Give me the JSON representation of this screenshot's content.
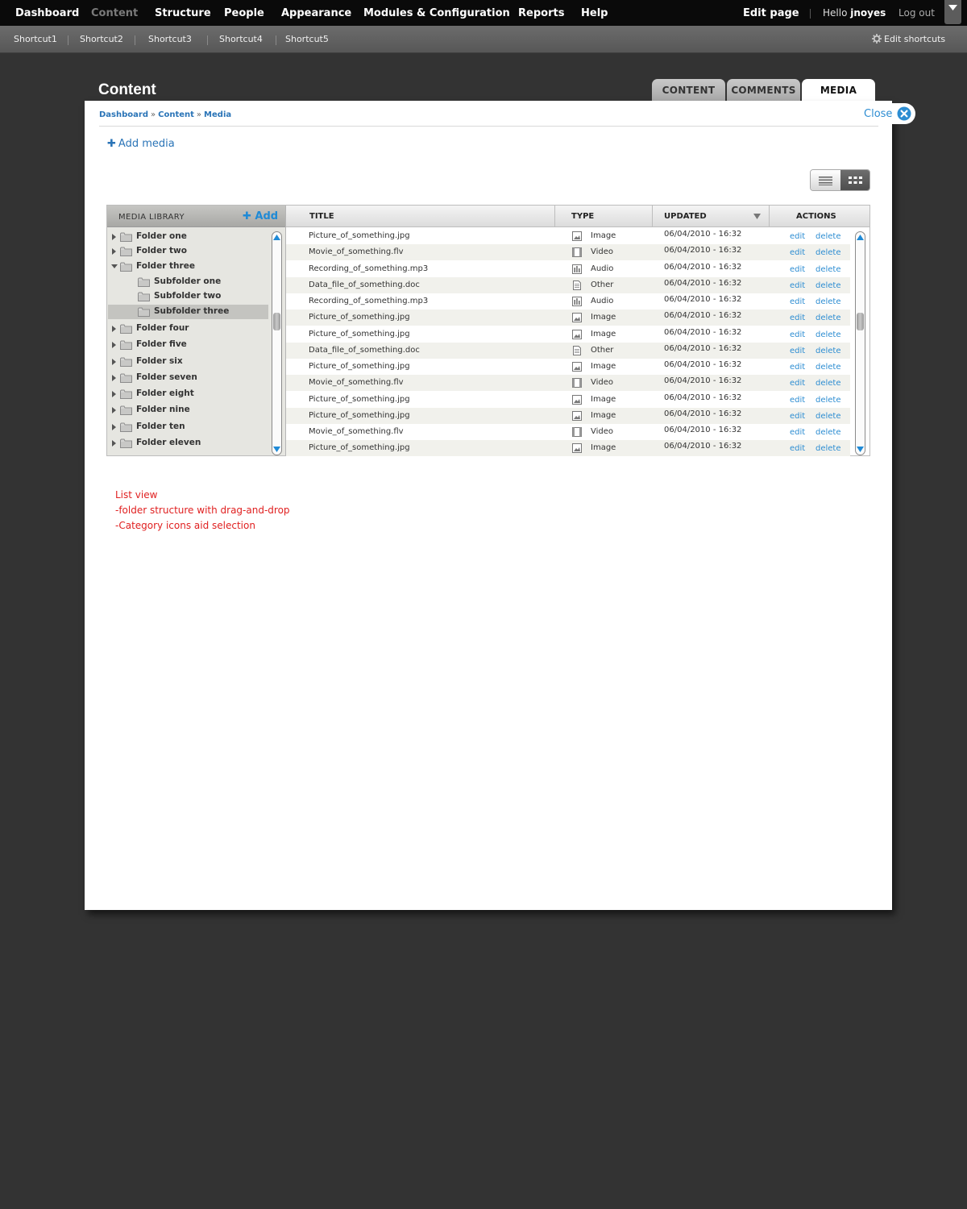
{
  "topbar": {
    "nav": [
      "Dashboard",
      "Content",
      "Structure",
      "People",
      "Appearance",
      "Modules & Configuration",
      "Reports",
      "Help"
    ],
    "edit_page": "Edit page",
    "hello": "Hello",
    "username": "jnoyes",
    "logout": "Log out"
  },
  "shortcuts": {
    "items": [
      "Shortcut1",
      "Shortcut2",
      "Shortcut3",
      "Shortcut4",
      "Shortcut5"
    ],
    "edit_label": "Edit shortcuts"
  },
  "page": {
    "title": "Content",
    "tabs": [
      "CONTENT",
      "COMMENTS",
      "MEDIA"
    ],
    "active_tab": "MEDIA",
    "close_label": "Close",
    "breadcrumb": [
      "Dashboard",
      "Content",
      "Media"
    ],
    "breadcrumb_separator": "»",
    "add_media": "Add media"
  },
  "media_library": {
    "title": "MEDIA LIBRARY",
    "add_label": "Add",
    "folders": [
      {
        "label": "Folder one",
        "level": 0,
        "expanded": false,
        "selected": false
      },
      {
        "label": "Folder two",
        "level": 0,
        "expanded": false,
        "selected": false
      },
      {
        "label": "Folder three",
        "level": 0,
        "expanded": true,
        "selected": false
      },
      {
        "label": "Subfolder one",
        "level": 1,
        "expanded": false,
        "selected": false
      },
      {
        "label": "Subfolder two",
        "level": 1,
        "expanded": false,
        "selected": false
      },
      {
        "label": "Subfolder three",
        "level": 1,
        "expanded": false,
        "selected": true
      },
      {
        "label": "Folder four",
        "level": 0,
        "expanded": false,
        "selected": false
      },
      {
        "label": "Folder five",
        "level": 0,
        "expanded": false,
        "selected": false
      },
      {
        "label": "Folder six",
        "level": 0,
        "expanded": false,
        "selected": false
      },
      {
        "label": "Folder seven",
        "level": 0,
        "expanded": false,
        "selected": false
      },
      {
        "label": "Folder eight",
        "level": 0,
        "expanded": false,
        "selected": false
      },
      {
        "label": "Folder nine",
        "level": 0,
        "expanded": false,
        "selected": false
      },
      {
        "label": "Folder ten",
        "level": 0,
        "expanded": false,
        "selected": false
      },
      {
        "label": "Folder eleven",
        "level": 0,
        "expanded": false,
        "selected": false
      }
    ]
  },
  "table": {
    "columns": [
      "TITLE",
      "TYPE",
      "UPDATED",
      "ACTIONS"
    ],
    "sorted_column": "UPDATED",
    "edit_label": "edit",
    "delete_label": "delete",
    "rows": [
      {
        "title": "Picture_of_something.jpg",
        "type": "Image",
        "icon": "image-icon",
        "updated": "06/04/2010 - 16:32"
      },
      {
        "title": "Movie_of_something.flv",
        "type": "Video",
        "icon": "video-icon",
        "updated": "06/04/2010 - 16:32"
      },
      {
        "title": "Recording_of_something.mp3",
        "type": "Audio",
        "icon": "audio-icon",
        "updated": "06/04/2010 - 16:32"
      },
      {
        "title": "Data_file_of_something.doc",
        "type": "Other",
        "icon": "document-icon",
        "updated": "06/04/2010 - 16:32"
      },
      {
        "title": "Recording_of_something.mp3",
        "type": "Audio",
        "icon": "audio-icon",
        "updated": "06/04/2010 - 16:32"
      },
      {
        "title": "Picture_of_something.jpg",
        "type": "Image",
        "icon": "image-icon",
        "updated": "06/04/2010 - 16:32"
      },
      {
        "title": "Picture_of_something.jpg",
        "type": "Image",
        "icon": "image-icon",
        "updated": "06/04/2010 - 16:32"
      },
      {
        "title": "Data_file_of_something.doc",
        "type": "Other",
        "icon": "document-icon",
        "updated": "06/04/2010 - 16:32"
      },
      {
        "title": "Picture_of_something.jpg",
        "type": "Image",
        "icon": "image-icon",
        "updated": "06/04/2010 - 16:32"
      },
      {
        "title": "Movie_of_something.flv",
        "type": "Video",
        "icon": "video-icon",
        "updated": "06/04/2010 - 16:32"
      },
      {
        "title": "Picture_of_something.jpg",
        "type": "Image",
        "icon": "image-icon",
        "updated": "06/04/2010 - 16:32"
      },
      {
        "title": "Picture_of_something.jpg",
        "type": "Image",
        "icon": "image-icon",
        "updated": "06/04/2010 - 16:32"
      },
      {
        "title": "Movie_of_something.flv",
        "type": "Video",
        "icon": "video-icon",
        "updated": "06/04/2010 - 16:32"
      },
      {
        "title": "Picture_of_something.jpg",
        "type": "Image",
        "icon": "image-icon",
        "updated": "06/04/2010 - 16:32"
      }
    ]
  },
  "notes": [
    "List view",
    "-folder structure with drag-and-drop",
    "-Category icons aid selection"
  ],
  "colors": {
    "link": "#2a74b7",
    "accent_blue": "#2d8dd2",
    "note_red": "#e02020",
    "background": "#333333"
  }
}
